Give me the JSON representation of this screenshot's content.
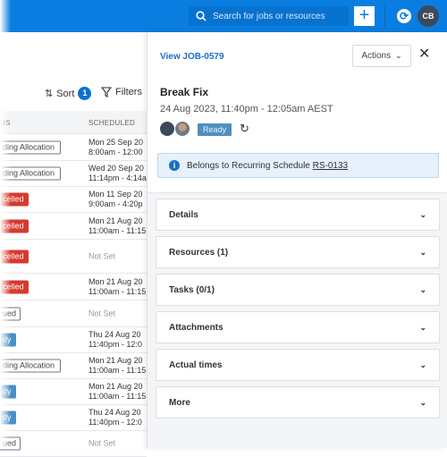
{
  "topbar": {
    "search_placeholder": "Search for jobs or resources",
    "add_icon": "plus-icon",
    "sync_icon": "sync-icon",
    "avatar_initials": "CB",
    "color": "#0a7ee0"
  },
  "toolbar": {
    "sort_label": "Sort",
    "sort_count": "1",
    "filters_label": "Filters"
  },
  "table": {
    "columns": [
      "US",
      "SCHEDULED"
    ],
    "rows": [
      {
        "status": "ding Allocation",
        "type": "out",
        "sched1": "Mon 25 Sep 20",
        "sched2": "8:00am - 12:00"
      },
      {
        "status": "ding Allocation",
        "type": "out",
        "sched1": "Wed 20 Sep 20",
        "sched2": "11:14pm - 4:14a"
      },
      {
        "status": "celled",
        "type": "red",
        "sched1": "Mon 11 Sep 20",
        "sched2": "9:00am - 4:20p"
      },
      {
        "status": "celled",
        "type": "red",
        "sched1": "Mon 21 Aug 20",
        "sched2": "11:00am - 11:15"
      },
      {
        "status": "celled",
        "type": "red",
        "sched1": "Not Set",
        "sched2": ""
      },
      {
        "status": "celled",
        "type": "red",
        "sched1": "Mon 21 Aug 20",
        "sched2": "11:00am - 11:15"
      },
      {
        "status": "ued",
        "type": "out",
        "sched1": "Not Set",
        "sched2": ""
      },
      {
        "status": "dy",
        "type": "blue",
        "sched1": "Thu 24 Aug 20",
        "sched2": "11:40pm - 12:0"
      },
      {
        "status": "ding Allocation",
        "type": "out",
        "sched1": "Mon 21 Aug 20",
        "sched2": "11:00am - 11:15"
      },
      {
        "status": "dy",
        "type": "blue",
        "sched1": "Mon 21 Aug 20",
        "sched2": "11:00am - 11:15"
      },
      {
        "status": "dy",
        "type": "blue",
        "sched1": "Thu 24 Aug 20",
        "sched2": "11:40pm - 12:0"
      },
      {
        "status": "ued",
        "type": "out",
        "sched1": "Not Set",
        "sched2": ""
      }
    ]
  },
  "panel": {
    "view_job": "View JOB-0579",
    "actions_label": "Actions",
    "title": "Break Fix",
    "date": "24 Aug 2023, 11:40pm - 12:05am AEST",
    "status": "Ready",
    "info_text": "Belongs to Recurring Schedule ",
    "info_link": "RS-0133",
    "sections": [
      "Details",
      "Resources (1)",
      "Tasks (0/1)",
      "Attachments",
      "Actual times",
      "More"
    ]
  }
}
